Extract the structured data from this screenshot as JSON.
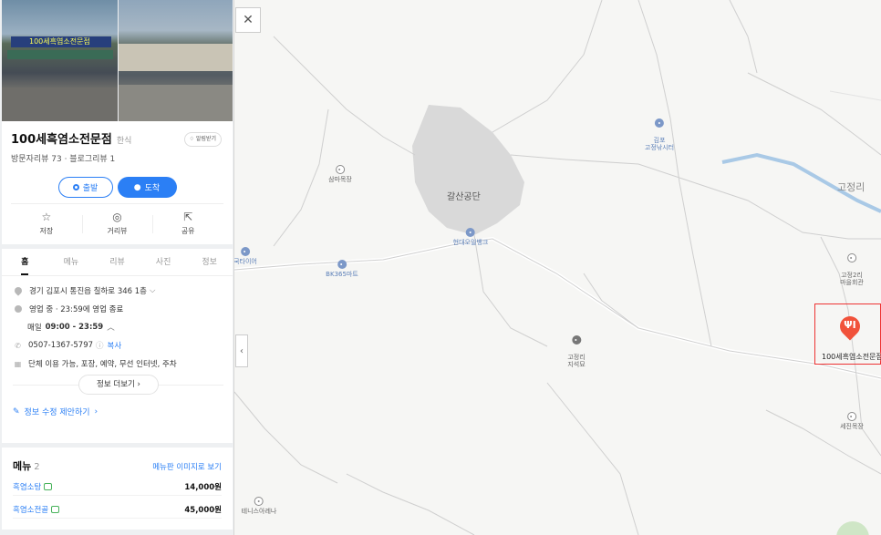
{
  "place": {
    "name": "100세흑염소전문점",
    "category": "한식",
    "alarm_label": "알림받기",
    "reviews": "방문자리뷰 73 · 블로그리뷰 1",
    "sign_text": "100세흑염소전문점"
  },
  "route": {
    "start_label": "출발",
    "arrive_label": "도착"
  },
  "actions": [
    {
      "label": "저장",
      "icon": "star-icon"
    },
    {
      "label": "거리뷰",
      "icon": "streetview-icon"
    },
    {
      "label": "공유",
      "icon": "share-icon"
    }
  ],
  "tabs": [
    "홈",
    "메뉴",
    "리뷰",
    "사진",
    "정보"
  ],
  "info": {
    "address": "경기 김포시 통진읍 칠하로 346 1층",
    "status": "영업 중 · 23:59에 영업 종료",
    "hours_label": "매일",
    "hours_value": "09:00 - 23:59",
    "phone": "0507-1367-5797",
    "copy_label": "복사",
    "amenities": "단체 이용 가능, 포장, 예약, 무선 인터넷, 주차",
    "more_label": "정보 더보기",
    "suggest_label": "정보 수정 제안하기"
  },
  "menu": {
    "title": "메뉴",
    "count": "2",
    "image_link": "메뉴판 이미지로 보기",
    "items": [
      {
        "name": "흑염소탕",
        "price": "14,000원"
      },
      {
        "name": "흑염소전골",
        "price": "45,000원"
      }
    ]
  },
  "map": {
    "pois": [
      {
        "label": "삼마목장",
        "style": "gray"
      },
      {
        "label": "김포\n고정낚시터",
        "style": "blue"
      },
      {
        "label": "현대오일뱅크",
        "style": "blue"
      },
      {
        "label": "국타이어",
        "style": "blue"
      },
      {
        "label": "BK365마트",
        "style": "blue"
      },
      {
        "label": "고정리\n지석묘",
        "style": "dark"
      },
      {
        "label": "고정2리\n마을회관",
        "style": "gray"
      },
      {
        "label": "세진목장",
        "style": "gray"
      },
      {
        "label": "테니스아레나",
        "style": "gray"
      }
    ],
    "area_label": "갈산공단",
    "region_label": "고정리",
    "marker_label": "100세흑염소전문점"
  }
}
